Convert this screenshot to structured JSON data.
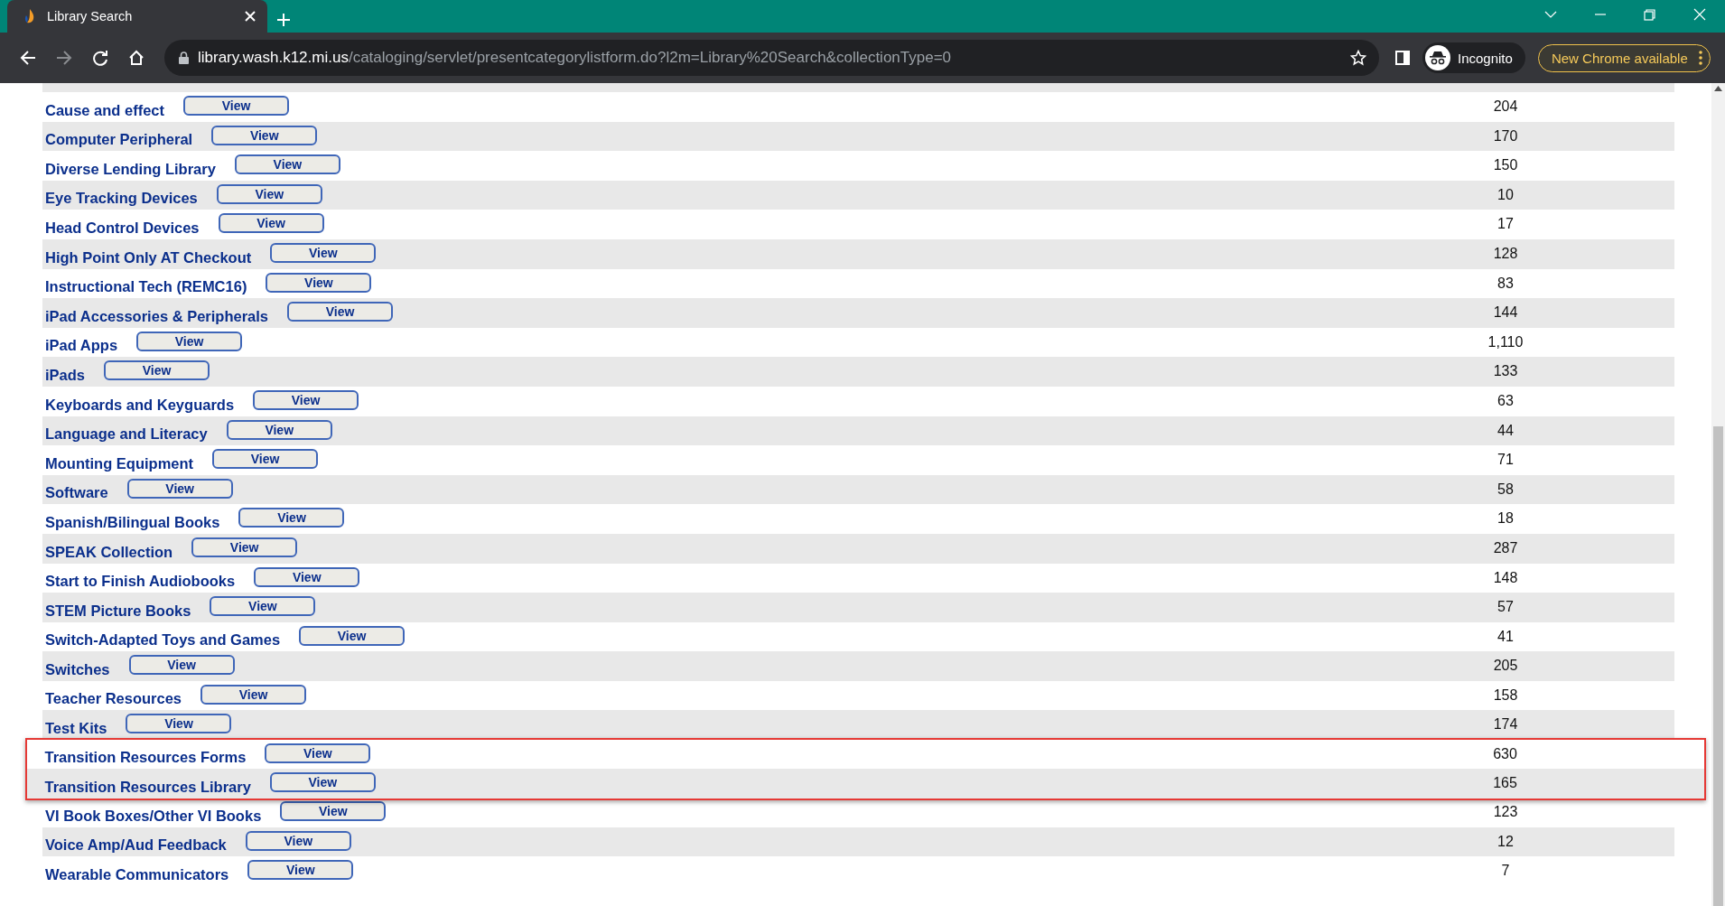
{
  "browser": {
    "tab_title": "Library Search",
    "url_domain": "library.wash.k12.mi.us",
    "url_path": "/cataloging/servlet/presentcategorylistform.do?l2m=Library%20Search&collectionType=0",
    "incognito_label": "Incognito",
    "update_label": "New Chrome available"
  },
  "rows": [
    {
      "name": "Cause and effect",
      "button": "View",
      "count": "204",
      "highlighted": false
    },
    {
      "name": "Computer Peripheral",
      "button": "View",
      "count": "170",
      "highlighted": false
    },
    {
      "name": "Diverse Lending Library",
      "button": "View",
      "count": "150",
      "highlighted": false
    },
    {
      "name": "Eye Tracking Devices",
      "button": "View",
      "count": "10",
      "highlighted": false
    },
    {
      "name": "Head Control Devices",
      "button": "View",
      "count": "17",
      "highlighted": false
    },
    {
      "name": "High Point Only AT Checkout",
      "button": "View",
      "count": "128",
      "highlighted": false
    },
    {
      "name": "Instructional Tech (REMC16)",
      "button": "View",
      "count": "83",
      "highlighted": false
    },
    {
      "name": "iPad Accessories & Peripherals",
      "button": "View",
      "count": "144",
      "highlighted": false
    },
    {
      "name": "iPad Apps",
      "button": "View",
      "count": "1,110",
      "highlighted": false
    },
    {
      "name": "iPads",
      "button": "View",
      "count": "133",
      "highlighted": false
    },
    {
      "name": "Keyboards and Keyguards",
      "button": "View",
      "count": "63",
      "highlighted": false
    },
    {
      "name": "Language and Literacy",
      "button": "View",
      "count": "44",
      "highlighted": false
    },
    {
      "name": "Mounting Equipment",
      "button": "View",
      "count": "71",
      "highlighted": false
    },
    {
      "name": "Software",
      "button": "View",
      "count": "58",
      "highlighted": false
    },
    {
      "name": "Spanish/Bilingual Books",
      "button": "View",
      "count": "18",
      "highlighted": false
    },
    {
      "name": "SPEAK Collection",
      "button": "View",
      "count": "287",
      "highlighted": false
    },
    {
      "name": "Start to Finish Audiobooks",
      "button": "View",
      "count": "148",
      "highlighted": false
    },
    {
      "name": "STEM Picture Books",
      "button": "View",
      "count": "57",
      "highlighted": false
    },
    {
      "name": "Switch-Adapted Toys and Games",
      "button": "View",
      "count": "41",
      "highlighted": false
    },
    {
      "name": "Switches",
      "button": "View",
      "count": "205",
      "highlighted": false
    },
    {
      "name": "Teacher Resources",
      "button": "View",
      "count": "158",
      "highlighted": false
    },
    {
      "name": "Test Kits",
      "button": "View",
      "count": "174",
      "highlighted": false
    },
    {
      "name": "Transition Resources Forms",
      "button": "View",
      "count": "630",
      "highlighted": true
    },
    {
      "name": "Transition Resources Library",
      "button": "View",
      "count": "165",
      "highlighted": true
    },
    {
      "name": "VI Book Boxes/Other VI Books",
      "button": "View",
      "count": "123",
      "highlighted": false
    },
    {
      "name": "Voice Amp/Aud Feedback",
      "button": "View",
      "count": "12",
      "highlighted": false
    },
    {
      "name": "Wearable Communicators",
      "button": "View",
      "count": "7",
      "highlighted": false
    }
  ]
}
